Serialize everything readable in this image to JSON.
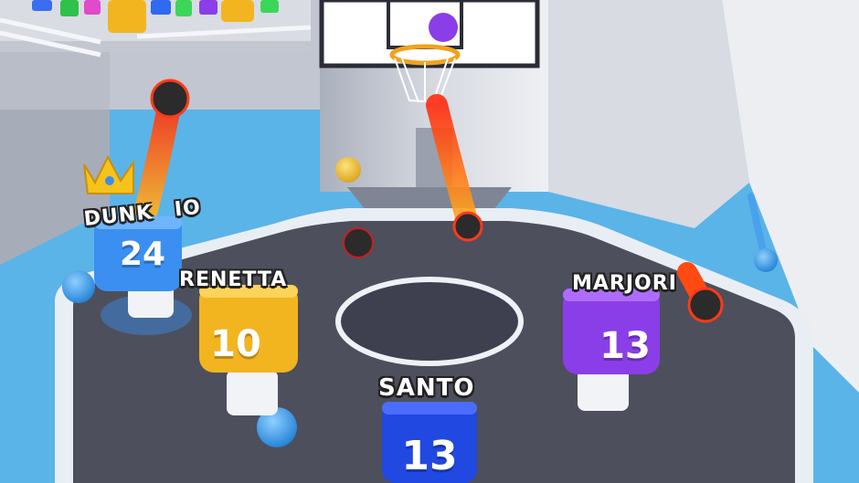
{
  "players": [
    {
      "name": "DUNK",
      "name_tail": "IO",
      "number": "24",
      "color": "#3a8ff0",
      "crown": true
    },
    {
      "name": "RENETTA",
      "number": "10",
      "color": "#f2b51f"
    },
    {
      "name": "MARJORI",
      "number": "13",
      "color": "#8a3ee8"
    },
    {
      "name": "SANTO",
      "number": "13",
      "color": "#2148e0"
    }
  ],
  "colors": {
    "court": "#4d4f5c",
    "court_rim": "#e9eef5",
    "wall": "#c9ccd4",
    "sky": "#5ab4e8",
    "ball": "#2b2b2b",
    "fire": "#ff5a1e"
  },
  "icons": [
    "crown-icon",
    "basketball-icon",
    "hoop-icon"
  ]
}
